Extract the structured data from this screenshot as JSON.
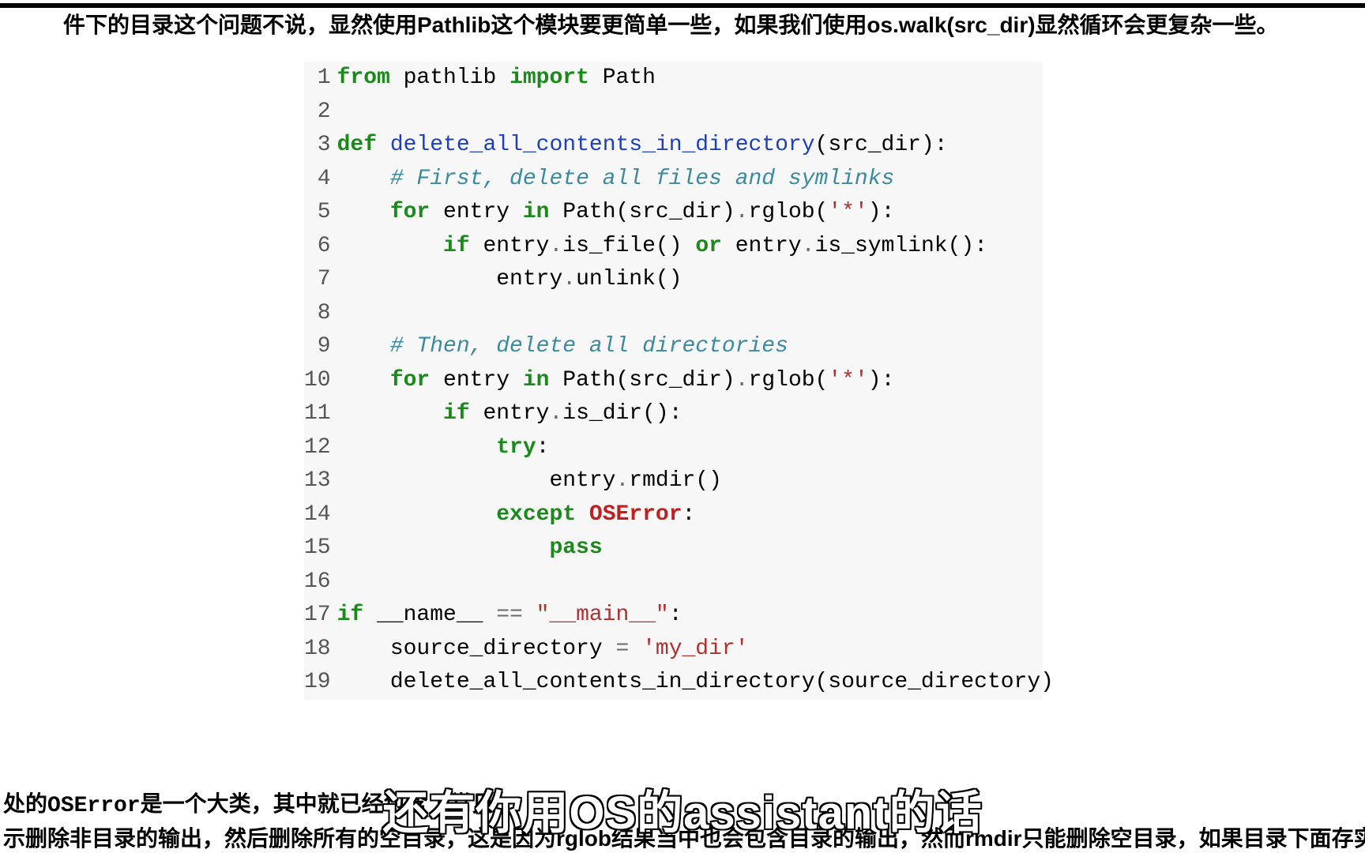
{
  "top_text": "件下的目录这个问题不说，显然使用Pathlib这个模块要更简单一些，如果我们使用os.walk(src_dir)显然循环会更复杂一些。",
  "bottom_text_line1_prefix": "处的",
  "bottom_text_line1_code": "OSError",
  "bottom_text_line1_rest": "是一个大类，其中就已经包含了常见",
  "bottom_text_line2": "示删除非目录的输出，然后删除所有的空目录，这是因为rglob结果当中也会包含目录的输出，然而rmdir只能删除空目录，如果目录下面存实实在",
  "caption": "还有你用OS的assistant的话",
  "code": {
    "lines": [
      [
        {
          "t": "from",
          "c": "kw"
        },
        {
          "t": " pathlib ",
          "c": ""
        },
        {
          "t": "import",
          "c": "kw"
        },
        {
          "t": " Path",
          "c": ""
        }
      ],
      [],
      [
        {
          "t": "def",
          "c": "kw"
        },
        {
          "t": " ",
          "c": ""
        },
        {
          "t": "delete_all_contents_in_directory",
          "c": "nm"
        },
        {
          "t": "(src_dir):",
          "c": ""
        }
      ],
      [
        {
          "t": "    ",
          "c": ""
        },
        {
          "t": "# First, delete all files and symlinks",
          "c": "cmt"
        }
      ],
      [
        {
          "t": "    ",
          "c": ""
        },
        {
          "t": "for",
          "c": "kw"
        },
        {
          "t": " entry ",
          "c": ""
        },
        {
          "t": "in",
          "c": "kw"
        },
        {
          "t": " Path(src_dir)",
          "c": ""
        },
        {
          "t": ".",
          "c": "op"
        },
        {
          "t": "rglob(",
          "c": ""
        },
        {
          "t": "'*'",
          "c": "str"
        },
        {
          "t": "):",
          "c": ""
        }
      ],
      [
        {
          "t": "        ",
          "c": ""
        },
        {
          "t": "if",
          "c": "kw"
        },
        {
          "t": " entry",
          "c": ""
        },
        {
          "t": ".",
          "c": "op"
        },
        {
          "t": "is_file() ",
          "c": ""
        },
        {
          "t": "or",
          "c": "kw"
        },
        {
          "t": " entry",
          "c": ""
        },
        {
          "t": ".",
          "c": "op"
        },
        {
          "t": "is_symlink():",
          "c": ""
        }
      ],
      [
        {
          "t": "            entry",
          "c": ""
        },
        {
          "t": ".",
          "c": "op"
        },
        {
          "t": "unlink()",
          "c": ""
        }
      ],
      [],
      [
        {
          "t": "    ",
          "c": ""
        },
        {
          "t": "# Then, delete all directories",
          "c": "cmt"
        }
      ],
      [
        {
          "t": "    ",
          "c": ""
        },
        {
          "t": "for",
          "c": "kw"
        },
        {
          "t": " entry ",
          "c": ""
        },
        {
          "t": "in",
          "c": "kw"
        },
        {
          "t": " Path(src_dir)",
          "c": ""
        },
        {
          "t": ".",
          "c": "op"
        },
        {
          "t": "rglob(",
          "c": ""
        },
        {
          "t": "'*'",
          "c": "str"
        },
        {
          "t": "):",
          "c": ""
        }
      ],
      [
        {
          "t": "        ",
          "c": ""
        },
        {
          "t": "if",
          "c": "kw"
        },
        {
          "t": " entry",
          "c": ""
        },
        {
          "t": ".",
          "c": "op"
        },
        {
          "t": "is_dir():",
          "c": ""
        }
      ],
      [
        {
          "t": "            ",
          "c": ""
        },
        {
          "t": "try",
          "c": "kw"
        },
        {
          "t": ":",
          "c": ""
        }
      ],
      [
        {
          "t": "                entry",
          "c": ""
        },
        {
          "t": ".",
          "c": "op"
        },
        {
          "t": "rmdir()",
          "c": ""
        }
      ],
      [
        {
          "t": "            ",
          "c": ""
        },
        {
          "t": "except",
          "c": "kw"
        },
        {
          "t": " ",
          "c": ""
        },
        {
          "t": "OSError",
          "c": "exc"
        },
        {
          "t": ":",
          "c": ""
        }
      ],
      [
        {
          "t": "                ",
          "c": ""
        },
        {
          "t": "pass",
          "c": "kw"
        }
      ],
      [],
      [
        {
          "t": "if",
          "c": "kw"
        },
        {
          "t": " __name__ ",
          "c": ""
        },
        {
          "t": "==",
          "c": "op"
        },
        {
          "t": " ",
          "c": ""
        },
        {
          "t": "\"__main__\"",
          "c": "str"
        },
        {
          "t": ":",
          "c": ""
        }
      ],
      [
        {
          "t": "    source_directory ",
          "c": ""
        },
        {
          "t": "=",
          "c": "op"
        },
        {
          "t": " ",
          "c": ""
        },
        {
          "t": "'my_dir'",
          "c": "str"
        }
      ],
      [
        {
          "t": "    delete_all_contents_in_directory(source_directory)",
          "c": ""
        }
      ]
    ]
  }
}
